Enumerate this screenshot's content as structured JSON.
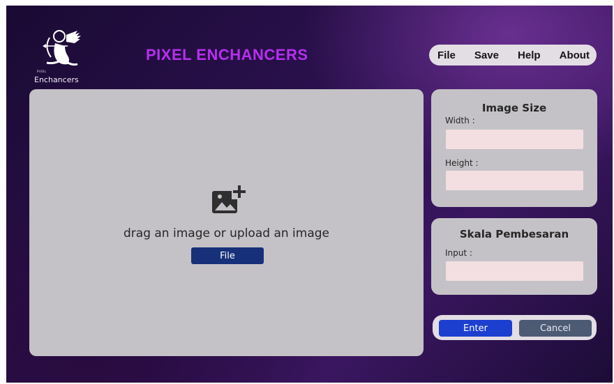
{
  "logo": {
    "small_text": "PIXEL",
    "text": "Enchancers"
  },
  "app_title": "PIXEL ENCHANCERS",
  "menu": {
    "items": [
      "File",
      "Save",
      "Help",
      "About"
    ]
  },
  "dropzone": {
    "prompt": "drag an image or upload an image",
    "file_button": "File",
    "icon": "add-image-icon"
  },
  "image_size": {
    "title": "Image Size",
    "width_label": "Width :",
    "width_value": "",
    "height_label": "Height :",
    "height_value": ""
  },
  "scale": {
    "title": "Skala Pembesaran",
    "input_label": "Input :",
    "input_value": ""
  },
  "actions": {
    "enter": "Enter",
    "cancel": "Cancel"
  },
  "colors": {
    "title": "#b72ff0",
    "file_button": "#16307a",
    "enter_button": "#1c3fd0",
    "cancel_button": "#4d5a74",
    "field_bg": "#f3dfe1"
  }
}
